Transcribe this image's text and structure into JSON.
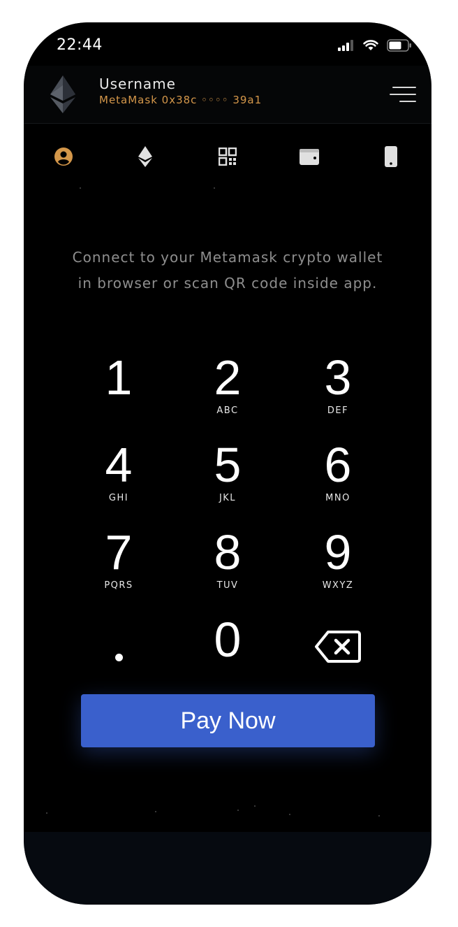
{
  "status_bar": {
    "time": "22:44",
    "signal_icon": "cellular-signal-icon",
    "wifi_icon": "wifi-icon",
    "battery_icon": "battery-icon"
  },
  "header": {
    "logo_icon": "ethereum-logo-icon",
    "username": "Username",
    "wallet_label": "MetaMask 0x38c ◦◦◦◦ 39a1",
    "menu_icon": "hamburger-menu-icon"
  },
  "tabs": [
    {
      "icon": "user-circle-icon",
      "active": true
    },
    {
      "icon": "ethereum-icon",
      "active": false
    },
    {
      "icon": "qr-code-icon",
      "active": false
    },
    {
      "icon": "wallet-icon",
      "active": false
    },
    {
      "icon": "mobile-phone-icon",
      "active": false
    }
  ],
  "instructions": "Connect to your Metamask crypto wallet in browser or scan QR code inside app.",
  "keypad": {
    "keys": [
      {
        "digit": "1",
        "letters": ""
      },
      {
        "digit": "2",
        "letters": "ABC"
      },
      {
        "digit": "3",
        "letters": "DEF"
      },
      {
        "digit": "4",
        "letters": "GHI"
      },
      {
        "digit": "5",
        "letters": "JKL"
      },
      {
        "digit": "6",
        "letters": "MNO"
      },
      {
        "digit": "7",
        "letters": "PQRS"
      },
      {
        "digit": "8",
        "letters": "TUV"
      },
      {
        "digit": "9",
        "letters": "WXYZ"
      },
      {
        "digit": "0",
        "letters": ""
      }
    ],
    "decimal_icon": "decimal-point-icon",
    "backspace_icon": "backspace-icon"
  },
  "pay_button": {
    "label": "Pay Now"
  },
  "colors": {
    "background": "#000000",
    "accent": "#d4974a",
    "button": "#3a60cc",
    "text_muted": "#8e8e8e"
  }
}
